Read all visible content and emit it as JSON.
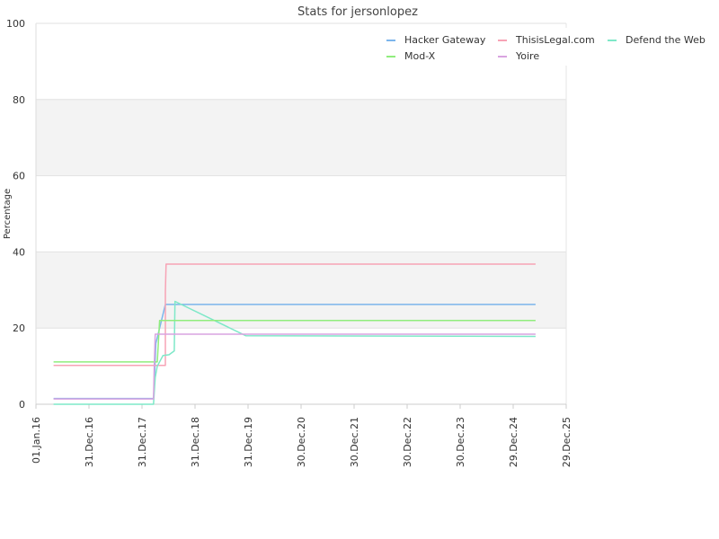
{
  "chart_data": {
    "type": "line",
    "title": "Stats for jersonlopez",
    "xlabel": "",
    "ylabel": "Percentage",
    "ylim": [
      0,
      100
    ],
    "y_ticks": [
      0,
      20,
      40,
      60,
      80,
      100
    ],
    "x_range": [
      "2016-01-01",
      "2025-12-29"
    ],
    "x_ticks": [
      {
        "date": "2016-01-01",
        "label": "01.Jan.16"
      },
      {
        "date": "2016-12-31",
        "label": "31.Dec.16"
      },
      {
        "date": "2017-12-31",
        "label": "31.Dec.17"
      },
      {
        "date": "2018-12-31",
        "label": "31.Dec.18"
      },
      {
        "date": "2019-12-31",
        "label": "31.Dec.19"
      },
      {
        "date": "2020-12-30",
        "label": "30.Dec.20"
      },
      {
        "date": "2021-12-30",
        "label": "30.Dec.21"
      },
      {
        "date": "2022-12-30",
        "label": "30.Dec.22"
      },
      {
        "date": "2023-12-30",
        "label": "30.Dec.23"
      },
      {
        "date": "2024-12-29",
        "label": "29.Dec.24"
      },
      {
        "date": "2025-12-29",
        "label": "29.Dec.25"
      }
    ],
    "grid": true,
    "legend_position": "top-right",
    "series": [
      {
        "name": "Hacker Gateway",
        "color": "#7cb5ec",
        "points": [
          [
            "2016-05-01",
            1.5
          ],
          [
            "2018-03-20",
            1.5
          ],
          [
            "2018-03-25",
            5
          ],
          [
            "2018-04-05",
            16
          ],
          [
            "2018-05-01",
            20
          ],
          [
            "2018-06-10",
            26.2
          ],
          [
            "2025-06-01",
            26.2
          ]
        ]
      },
      {
        "name": "ThisisLegal.com",
        "color": "#f7a3b5",
        "points": [
          [
            "2016-05-01",
            10.2
          ],
          [
            "2018-06-10",
            10.2
          ],
          [
            "2018-06-10",
            29.5
          ],
          [
            "2018-06-15",
            36.8
          ],
          [
            "2025-06-01",
            36.8
          ]
        ]
      },
      {
        "name": "Defend the Web",
        "color": "#7ee8c8",
        "points": [
          [
            "2016-05-01",
            0
          ],
          [
            "2018-03-20",
            0
          ],
          [
            "2018-04-01",
            7
          ],
          [
            "2018-04-15",
            10
          ],
          [
            "2018-05-25",
            12.8
          ],
          [
            "2018-07-05",
            13
          ],
          [
            "2018-08-10",
            14
          ],
          [
            "2018-08-15",
            27
          ],
          [
            "2019-12-15",
            18
          ],
          [
            "2025-06-01",
            17.8
          ]
        ]
      },
      {
        "name": "Mod-X",
        "color": "#90ed7d",
        "points": [
          [
            "2016-05-01",
            11.1
          ],
          [
            "2018-04-15",
            11.1
          ],
          [
            "2018-05-01",
            22
          ],
          [
            "2025-06-01",
            22
          ]
        ]
      },
      {
        "name": "Yoire",
        "color": "#d9a3e0",
        "points": [
          [
            "2016-05-01",
            1.4
          ],
          [
            "2018-03-20",
            1.4
          ],
          [
            "2018-03-25",
            10
          ],
          [
            "2018-04-01",
            18.4
          ],
          [
            "2025-06-01",
            18.4
          ]
        ]
      }
    ]
  }
}
